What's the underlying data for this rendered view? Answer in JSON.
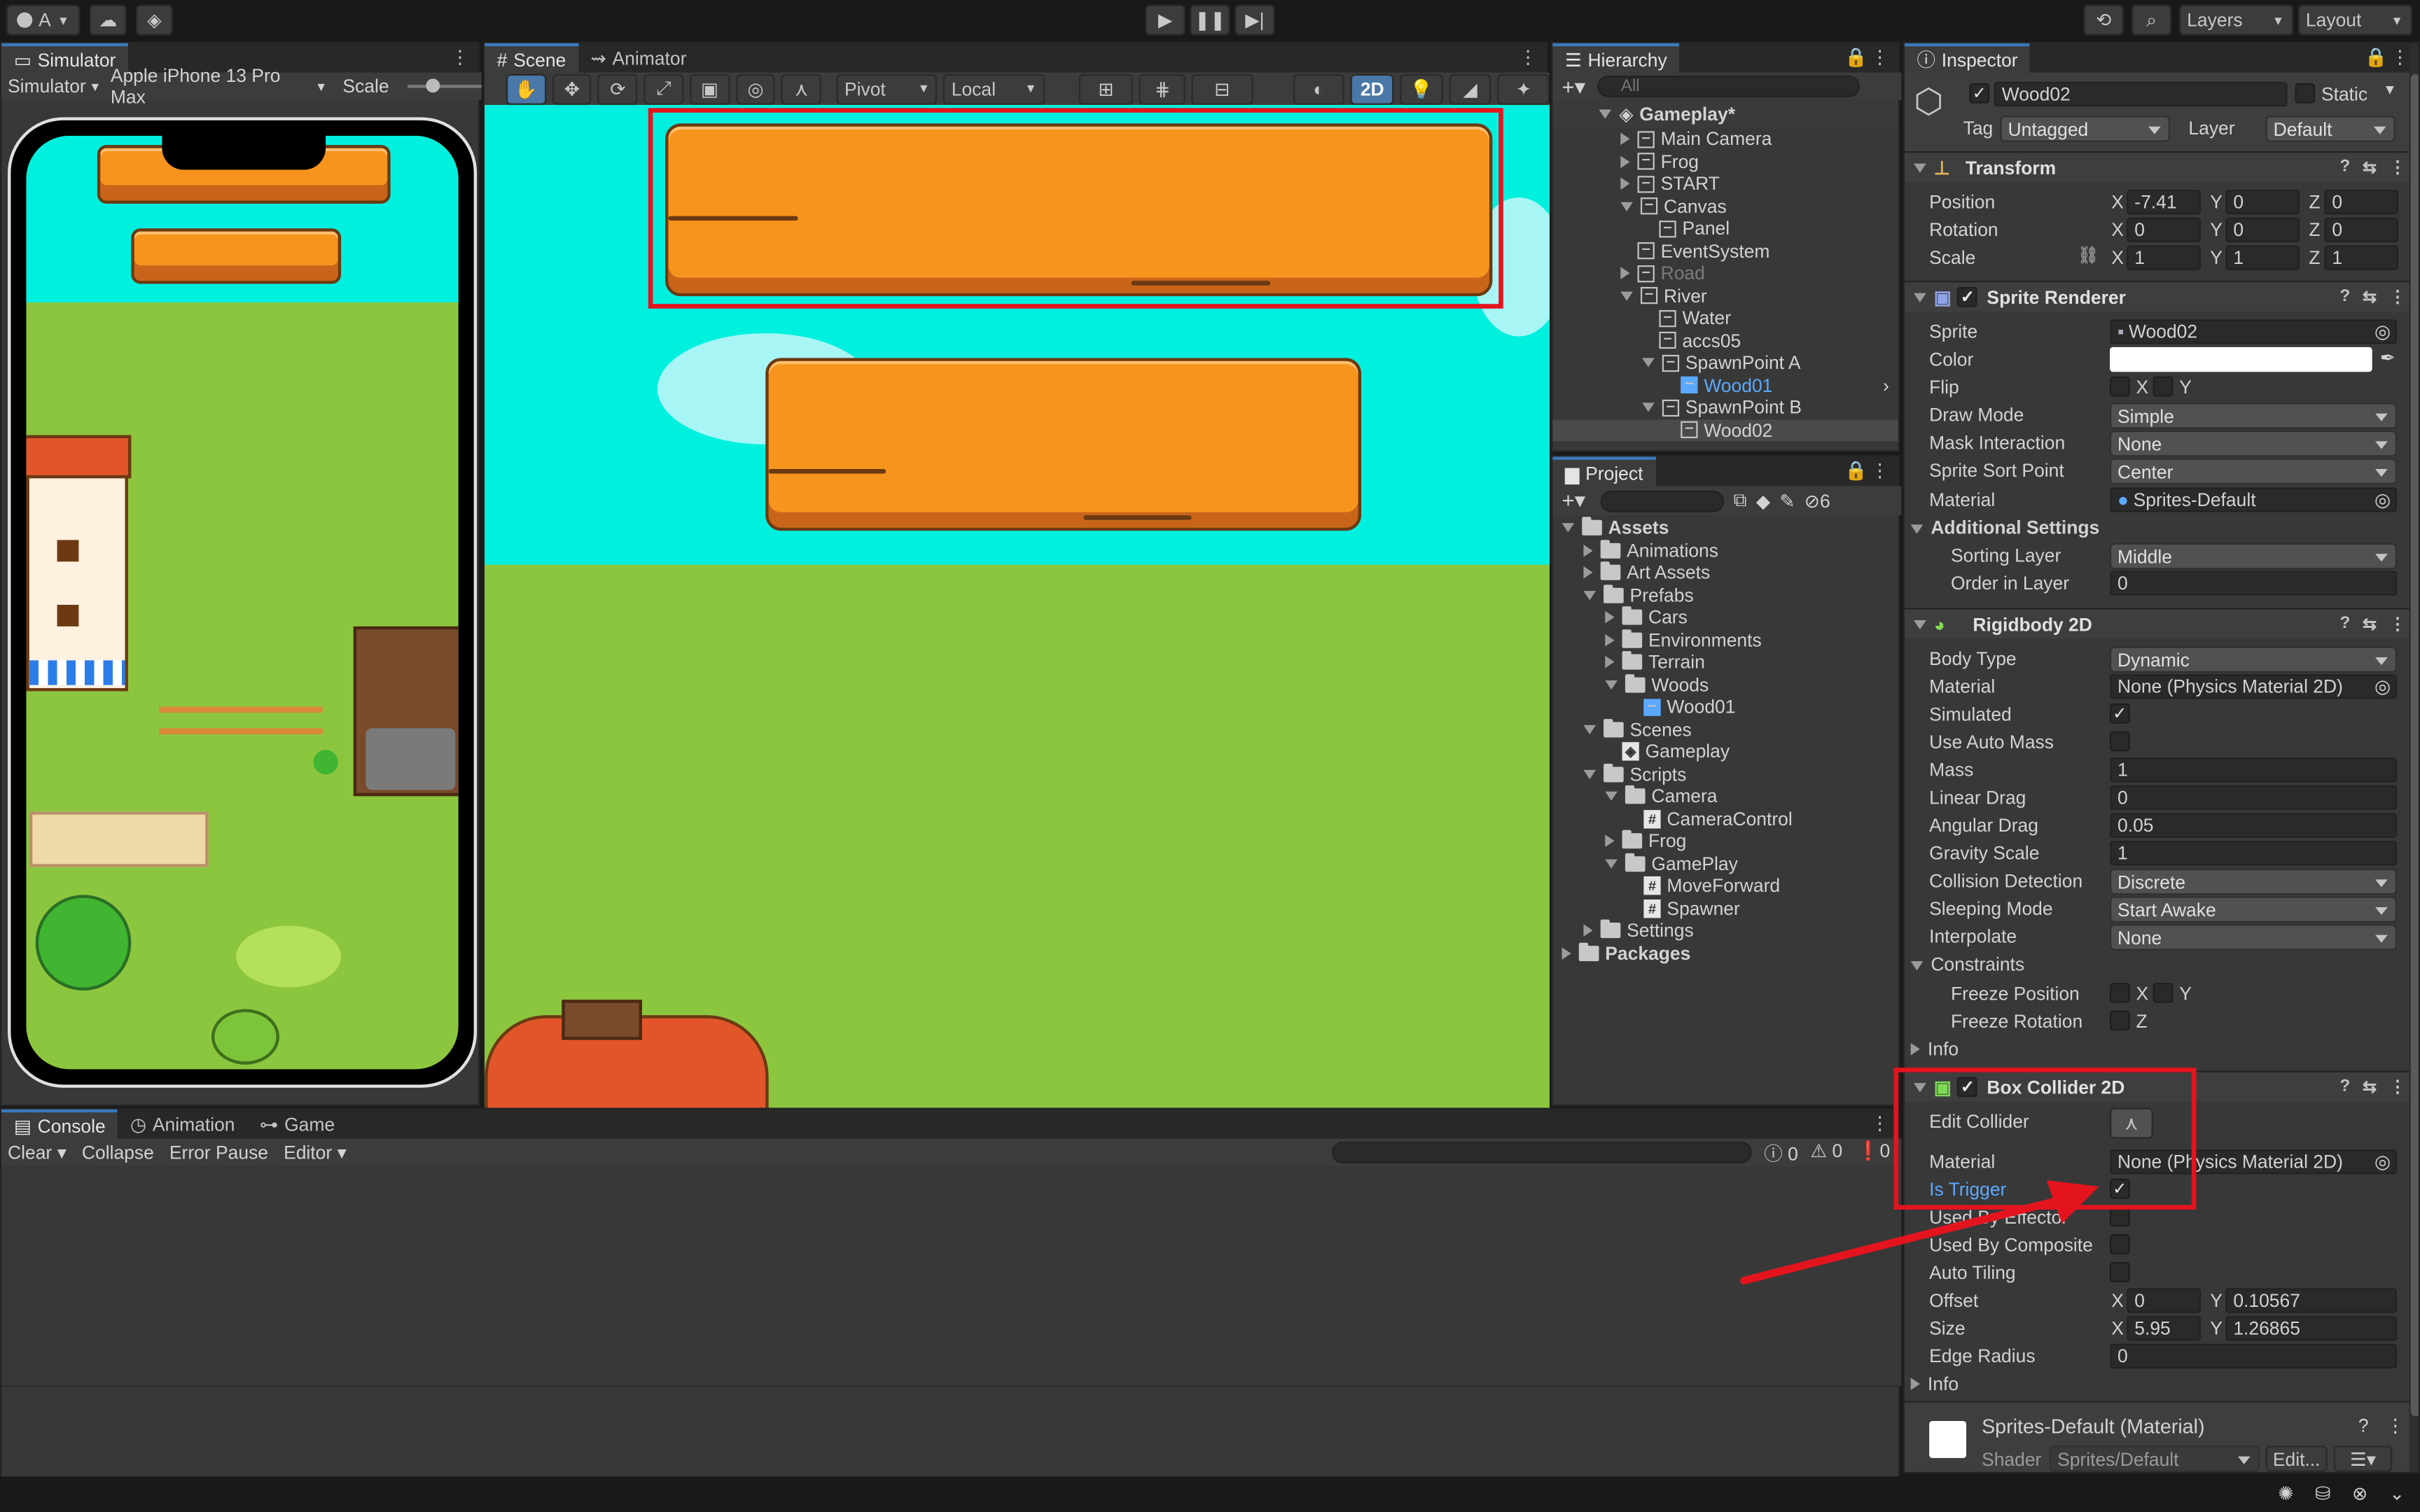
{
  "toolbar": {
    "account_label": "A",
    "layers_label": "Layers",
    "layout_label": "Layout"
  },
  "simulator": {
    "tab": "Simulator",
    "mode": "Simulator",
    "device": "Apple iPhone 13 Pro Max",
    "scale_label": "Scale"
  },
  "scene": {
    "tabs": [
      "Scene",
      "Animator"
    ],
    "pivot": "Pivot",
    "local": "Local",
    "mode_2d": "2D"
  },
  "hierarchy": {
    "tab": "Hierarchy",
    "search_placeholder": "All",
    "scene_name": "Gameplay*",
    "items": [
      {
        "label": "Main Camera"
      },
      {
        "label": "Frog"
      },
      {
        "label": "START"
      },
      {
        "label": "Canvas"
      },
      {
        "label": "Panel"
      },
      {
        "label": "EventSystem"
      },
      {
        "label": "Road"
      },
      {
        "label": "River"
      },
      {
        "label": "Water"
      },
      {
        "label": "accs05"
      },
      {
        "label": "SpawnPoint A"
      },
      {
        "label": "Wood01"
      },
      {
        "label": "SpawnPoint B"
      },
      {
        "label": "Wood02"
      }
    ]
  },
  "project": {
    "tab": "Project",
    "hidden_count": "6",
    "items": [
      {
        "label": "Assets"
      },
      {
        "label": "Animations"
      },
      {
        "label": "Art Assets"
      },
      {
        "label": "Prefabs"
      },
      {
        "label": "Cars"
      },
      {
        "label": "Environments"
      },
      {
        "label": "Terrain"
      },
      {
        "label": "Woods"
      },
      {
        "label": "Wood01"
      },
      {
        "label": "Scenes"
      },
      {
        "label": "Gameplay"
      },
      {
        "label": "Scripts"
      },
      {
        "label": "Camera"
      },
      {
        "label": "CameraControl"
      },
      {
        "label": "Frog"
      },
      {
        "label": "GamePlay"
      },
      {
        "label": "MoveForward"
      },
      {
        "label": "Spawner"
      },
      {
        "label": "Settings"
      },
      {
        "label": "Packages"
      }
    ]
  },
  "console": {
    "tabs": [
      "Console",
      "Animation",
      "Game"
    ],
    "clear": "Clear",
    "collapse": "Collapse",
    "error_pause": "Error Pause",
    "editor": "Editor",
    "info_count": "0",
    "warn_count": "0",
    "error_count": "0"
  },
  "inspector": {
    "tab": "Inspector",
    "object_name": "Wood02",
    "static_label": "Static",
    "tag_label": "Tag",
    "tag_value": "Untagged",
    "layer_label": "Layer",
    "layer_value": "Default",
    "transform": {
      "title": "Transform",
      "position_label": "Position",
      "pos_x": "-7.41",
      "pos_y": "0",
      "pos_z": "0",
      "rotation_label": "Rotation",
      "rot_x": "0",
      "rot_y": "0",
      "rot_z": "0",
      "scale_label": "Scale",
      "scale_x": "1",
      "scale_y": "1",
      "scale_z": "1"
    },
    "sprite_renderer": {
      "title": "Sprite Renderer",
      "sprite_label": "Sprite",
      "sprite_value": "Wood02",
      "color_label": "Color",
      "flip_label": "Flip",
      "flip_x": "X",
      "flip_y": "Y",
      "draw_mode_label": "Draw Mode",
      "draw_mode_value": "Simple",
      "mask_label": "Mask Interaction",
      "mask_value": "None",
      "sort_point_label": "Sprite Sort Point",
      "sort_point_value": "Center",
      "material_label": "Material",
      "material_value": "Sprites-Default",
      "additional_label": "Additional Settings",
      "sorting_layer_label": "Sorting Layer",
      "sorting_layer_value": "Middle",
      "order_label": "Order in Layer",
      "order_value": "0"
    },
    "rigidbody": {
      "title": "Rigidbody 2D",
      "body_type_label": "Body Type",
      "body_type_value": "Dynamic",
      "material_label": "Material",
      "material_value": "None (Physics Material 2D)",
      "simulated_label": "Simulated",
      "auto_mass_label": "Use Auto Mass",
      "mass_label": "Mass",
      "mass_value": "1",
      "linear_drag_label": "Linear Drag",
      "linear_drag_value": "0",
      "angular_drag_label": "Angular Drag",
      "angular_drag_value": "0.05",
      "gravity_label": "Gravity Scale",
      "gravity_value": "1",
      "collision_label": "Collision Detection",
      "collision_value": "Discrete",
      "sleeping_label": "Sleeping Mode",
      "sleeping_value": "Start Awake",
      "interpolate_label": "Interpolate",
      "interpolate_value": "None",
      "constraints_label": "Constraints",
      "freeze_pos_label": "Freeze Position",
      "freeze_rot_label": "Freeze Rotation",
      "x": "X",
      "y": "Y",
      "z": "Z",
      "info_label": "Info"
    },
    "box_collider": {
      "title": "Box Collider 2D",
      "edit_label": "Edit Collider",
      "material_label": "Material",
      "material_value": "None (Physics Material 2D)",
      "trigger_label": "Is Trigger",
      "effector_label": "Used By Effector",
      "composite_label": "Used By Composite",
      "tiling_label": "Auto Tiling",
      "offset_label": "Offset",
      "offset_x": "0",
      "offset_y": "0.10567",
      "size_label": "Size",
      "size_x": "5.95",
      "size_y": "1.26865",
      "edge_label": "Edge Radius",
      "edge_value": "0",
      "info_label": "Info"
    },
    "material": {
      "name": "Sprites-Default (Material)",
      "shader_label": "Shader",
      "shader_value": "Sprites/Default",
      "edit_label": "Edit..."
    }
  },
  "colors": {
    "highlight_red": "#e4141e",
    "water": "#00f0e0",
    "grass": "#8cc63f",
    "plank": "#f7941d",
    "selection": "#2c5d87",
    "link_blue": "#5aa9ff"
  }
}
